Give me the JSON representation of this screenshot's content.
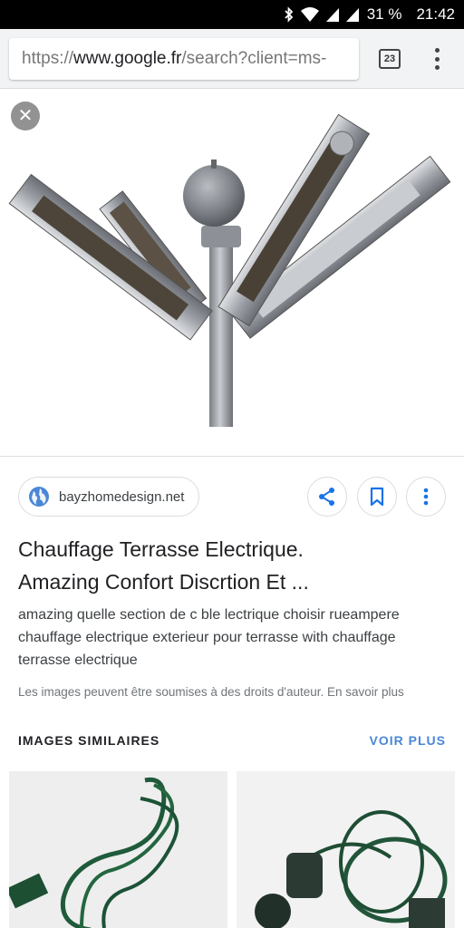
{
  "status_bar": {
    "battery": "31 %",
    "time": "21:42"
  },
  "browser": {
    "url_prefix": "https://",
    "url_host": "www.google.fr",
    "url_path": "/search?client=ms-",
    "tab_count": "23"
  },
  "result": {
    "source": "bayzhomedesign.net",
    "title_line1": "Chauffage Terrasse Electrique.",
    "title_line2": "Amazing Confort Discrtion Et ...",
    "description": "amazing quelle section de c ble lectrique choisir rueampere chauffage electrique exterieur pour terrasse with chauffage terrasse electrique",
    "copyright": "Les images peuvent être soumises à des droits d'auteur. En savoir plus"
  },
  "similar": {
    "heading": "IMAGES SIMILAIRES",
    "more_label": "VOIR PLUS"
  },
  "colors": {
    "accent": "#4a87d6",
    "icon_blue": "#1a73e8"
  }
}
